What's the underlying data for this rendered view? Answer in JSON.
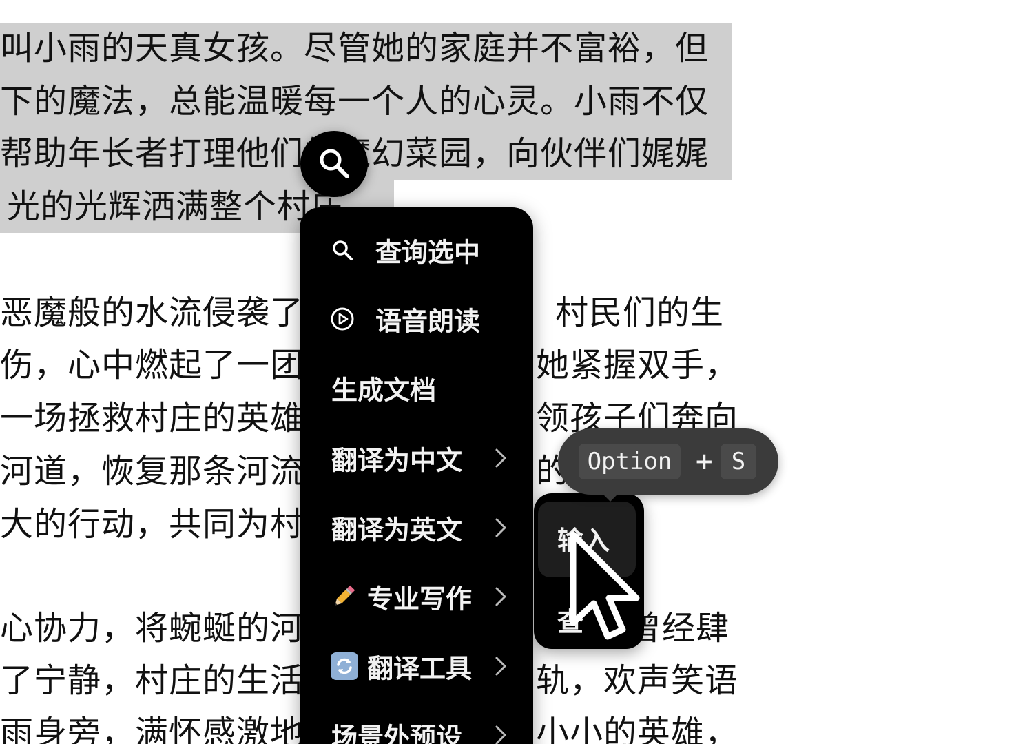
{
  "document": {
    "selected_lines": [
      "叫小雨的天真女孩。尽管她的家庭并不富裕，但",
      "下的魔法，总能温暖每一个人的心灵。小雨不仅",
      "帮助年长者打理他们的魔幻菜园，向伙伴们娓娓",
      "光的光辉洒满整个村庄"
    ],
    "para2_left": [
      "恶魔般的水流侵袭了",
      "伤，心中燃起了一团",
      "一场拯救村庄的英雄",
      "河道，恢复那条河流",
      "大的行动，共同为村"
    ],
    "para2_right": [
      "村民们的生",
      "她紧握双手，",
      "领孩子们奔向",
      "的"
    ],
    "para3_left": [
      "心协力，将蜿蜒的河",
      "了宁静，村庄的生活",
      "雨身旁，满怀感激地"
    ],
    "para3_right": [
      "曾经肆",
      "轨，欢声笑语",
      "小小的英雄，"
    ]
  },
  "search_bubble": {
    "icon": "search-icon"
  },
  "menu": {
    "items": [
      {
        "label": "查询选中",
        "icon": "search-icon",
        "has_submenu": false
      },
      {
        "label": "语音朗读",
        "icon": "play-circle-icon",
        "has_submenu": false
      },
      {
        "label": "生成文档",
        "icon": "",
        "has_submenu": false
      },
      {
        "label": "翻译为中文",
        "icon": "",
        "has_submenu": true
      },
      {
        "label": "翻译为英文",
        "icon": "",
        "has_submenu": true
      },
      {
        "label": "专业写作",
        "icon": "pencil-icon",
        "has_submenu": true
      },
      {
        "label": "翻译工具",
        "icon": "refresh-icon",
        "has_submenu": true
      },
      {
        "label": "场景外预设",
        "icon": "",
        "has_submenu": true
      }
    ]
  },
  "submenu": {
    "items": [
      {
        "label": "输入",
        "hovered": true
      },
      {
        "label": "查",
        "hovered": false
      }
    ]
  },
  "tooltip": {
    "key1": "Option",
    "plus": "+",
    "key2": "S"
  },
  "colors": {
    "menu_bg": "#000000",
    "selection": "#cfcfcf",
    "tooltip_bg": "#3b3b3b"
  }
}
